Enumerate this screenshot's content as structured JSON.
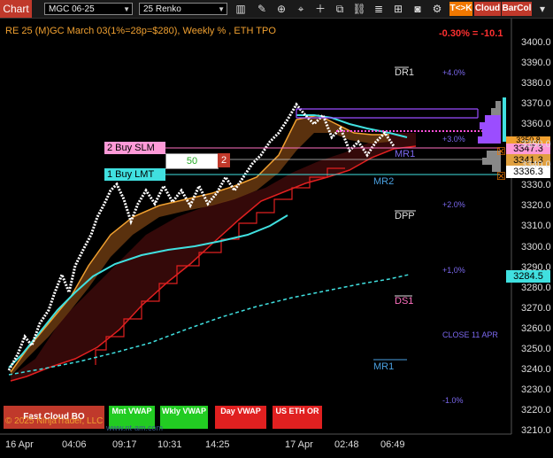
{
  "toolbar": {
    "chart_tab": "Chart",
    "instrument": "MGC 06-25",
    "bar_type": "25 Renko",
    "btn_tk": "T<>K",
    "btn_cloud": "Cloud",
    "btn_barcol": "BarCol"
  },
  "chart": {
    "title": "RE 25 (M)GC March 03(1%=28p=$280), Weekly % , ETH TPO",
    "pct_change": "-0.30% = -10.1",
    "copyright": "© 2025 NinjaTrader, LLC",
    "watermark": "www.nt-am.com"
  },
  "levels": {
    "dr1": "DR1",
    "mr1_upper": "MR1",
    "mr2": "MR2",
    "dpp": "DPP",
    "ds1": "DS1",
    "mr1_lower": "MR1",
    "close_label": "CLOSE 11 APR"
  },
  "pct_levels": {
    "p4": "+4.0%",
    "p3": "+3.0%",
    "p2": "+2.0%",
    "p1": "+1,0%",
    "m1": "-1.0%"
  },
  "orders": {
    "sell": "2 Buy SLM",
    "buy": "1 Buy LMT",
    "qty": "50",
    "count": "2"
  },
  "price_boxes": {
    "b1": "3347.3",
    "b2": "3341.3",
    "b3": "3336.3",
    "b4": "3350.8",
    "b5": "3284.5"
  },
  "price_axis": [
    "3400.0",
    "3390.0",
    "3380.0",
    "3370.0",
    "3360.0",
    "3350.0",
    "3340.0",
    "3330.0",
    "3320.0",
    "3310.0",
    "3300.0",
    "3290.0",
    "3280.0",
    "3270.0",
    "3260.0",
    "3250.0",
    "3240.0",
    "3230.0",
    "3220.0",
    "3210.0"
  ],
  "time_axis": [
    "16 Apr",
    "04:06",
    "09:17",
    "10:31",
    "14:25",
    "17 Apr",
    "02:48",
    "06:49"
  ],
  "indicators": {
    "fast_cloud": "Fast Cloud BO",
    "mnt_vwap": "Mnt VWAP",
    "wkly_vwap": "Wkly VWAP",
    "day_vwap": "Day VWAP",
    "us_eth_or": "US ETH OR"
  },
  "colors": {
    "accent": "#c0392b",
    "vwap_cyan": "#40e0e0",
    "orange": "#f0a030",
    "red": "#e02020",
    "purple": "#9b4dff",
    "green": "#22cc22"
  }
}
